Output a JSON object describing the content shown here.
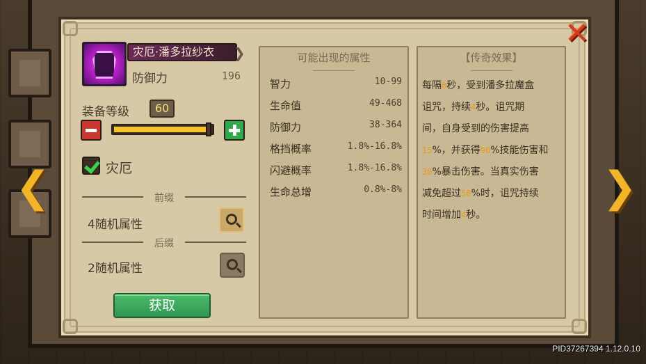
{
  "item": {
    "name": "灾厄·潘多拉纱衣",
    "stat_label": "防御力",
    "stat_value": "196",
    "icon": "purple-armor-icon"
  },
  "level": {
    "label": "装备等级",
    "value": "60",
    "slider_fraction": 1.0
  },
  "curse": {
    "label": "灾厄",
    "checked": true
  },
  "prefix": {
    "divider": "前缀",
    "text": "4随机属性"
  },
  "suffix": {
    "divider": "后缀",
    "text": "2随机属性"
  },
  "acquire_button": "获取",
  "attributes": {
    "title": "可能出现的属性",
    "rows": [
      {
        "name": "智力",
        "range": "10-99"
      },
      {
        "name": "生命值",
        "range": "49-468"
      },
      {
        "name": "防御力",
        "range": "38-364"
      },
      {
        "name": "格挡概率",
        "range": "1.8%-16.8%"
      },
      {
        "name": "闪避概率",
        "range": "1.8%-16.8%"
      },
      {
        "name": "生命总增",
        "range": "0.8%-8%"
      }
    ]
  },
  "legend": {
    "title": "【传奇效果】",
    "lines": [
      [
        "每隔",
        "8",
        "秒，受到潘多拉魔盒"
      ],
      [
        "诅咒，持续",
        "4",
        "秒。诅咒期"
      ],
      [
        "间，自身受到的伤害提高"
      ],
      [
        "",
        "15",
        "%，并获得",
        "90",
        "%技能伤害和"
      ],
      [
        "",
        "30",
        "%暴击伤害。当真实伤害"
      ],
      [
        "减免超过",
        "50",
        "%时，诅咒持续"
      ],
      [
        "时间增加",
        "4",
        "秒。"
      ]
    ]
  },
  "version": "PID37267394 1.12.0.10",
  "colors": {
    "highlight": "#e89a1c",
    "panel": "#d7c9a6",
    "acquire": "#3aa85a"
  }
}
